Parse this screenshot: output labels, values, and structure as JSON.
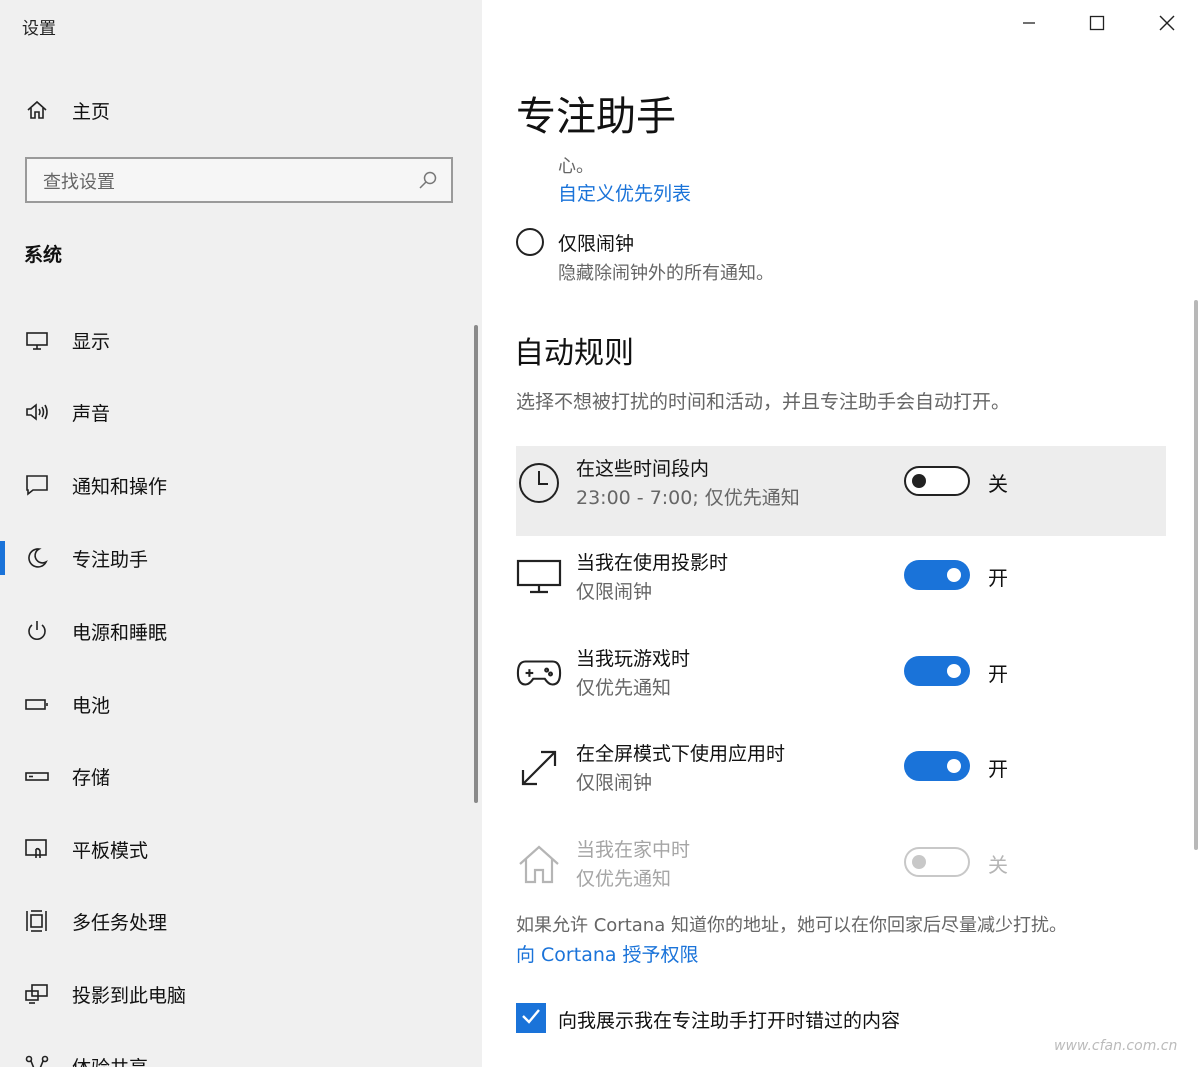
{
  "window": {
    "title": "设置"
  },
  "sidebar": {
    "home": {
      "label": "主页",
      "icon": "home-icon"
    },
    "search": {
      "placeholder": "查找设置"
    },
    "section": "系统",
    "items": [
      {
        "label": "显示",
        "icon": "monitor-icon"
      },
      {
        "label": "声音",
        "icon": "speaker-icon"
      },
      {
        "label": "通知和操作",
        "icon": "message-icon"
      },
      {
        "label": "专注助手",
        "icon": "moon-icon",
        "selected": true
      },
      {
        "label": "电源和睡眠",
        "icon": "power-icon"
      },
      {
        "label": "电池",
        "icon": "battery-icon"
      },
      {
        "label": "存储",
        "icon": "storage-icon"
      },
      {
        "label": "平板模式",
        "icon": "tablet-icon"
      },
      {
        "label": "多任务处理",
        "icon": "multitask-icon"
      },
      {
        "label": "投影到此电脑",
        "icon": "project-icon"
      },
      {
        "label": "体验共享",
        "icon": "share-icon"
      }
    ]
  },
  "main": {
    "title": "专注助手",
    "trailing_text": "心。",
    "customize_link": "自定义优先列表",
    "alarm_option": {
      "label": "仅限闹钟",
      "desc": "隐藏除闹钟外的所有通知。"
    },
    "auto_rules": {
      "heading": "自动规则",
      "desc": "选择不想被打扰的时间和活动，并且专注助手会自动打开。",
      "rules": [
        {
          "title": "在这些时间段内",
          "sub": "23:00 - 7:00; 仅优先通知",
          "state": "关",
          "icon": "clock-icon"
        },
        {
          "title": "当我在使用投影时",
          "sub": "仅限闹钟",
          "state": "开",
          "icon": "monitor-icon"
        },
        {
          "title": "当我玩游戏时",
          "sub": "仅优先通知",
          "state": "开",
          "icon": "gamepad-icon"
        },
        {
          "title": "在全屏模式下使用应用时",
          "sub": "仅限闹钟",
          "state": "开",
          "icon": "fullscreen-icon"
        },
        {
          "title": "当我在家中时",
          "sub": "仅优先通知",
          "state": "关",
          "icon": "house-icon"
        }
      ]
    },
    "cortana_note": "如果允许 Cortana 知道你的地址，她可以在你回家后尽量减少打扰。",
    "cortana_link": "向 Cortana 授予权限",
    "missed_checkbox": "向我展示我在专注助手打开时错过的内容"
  },
  "watermark": "www.cfan.com.cn",
  "colors": {
    "accent": "#1a73d9",
    "sidebar_bg": "#f0f0f0"
  }
}
